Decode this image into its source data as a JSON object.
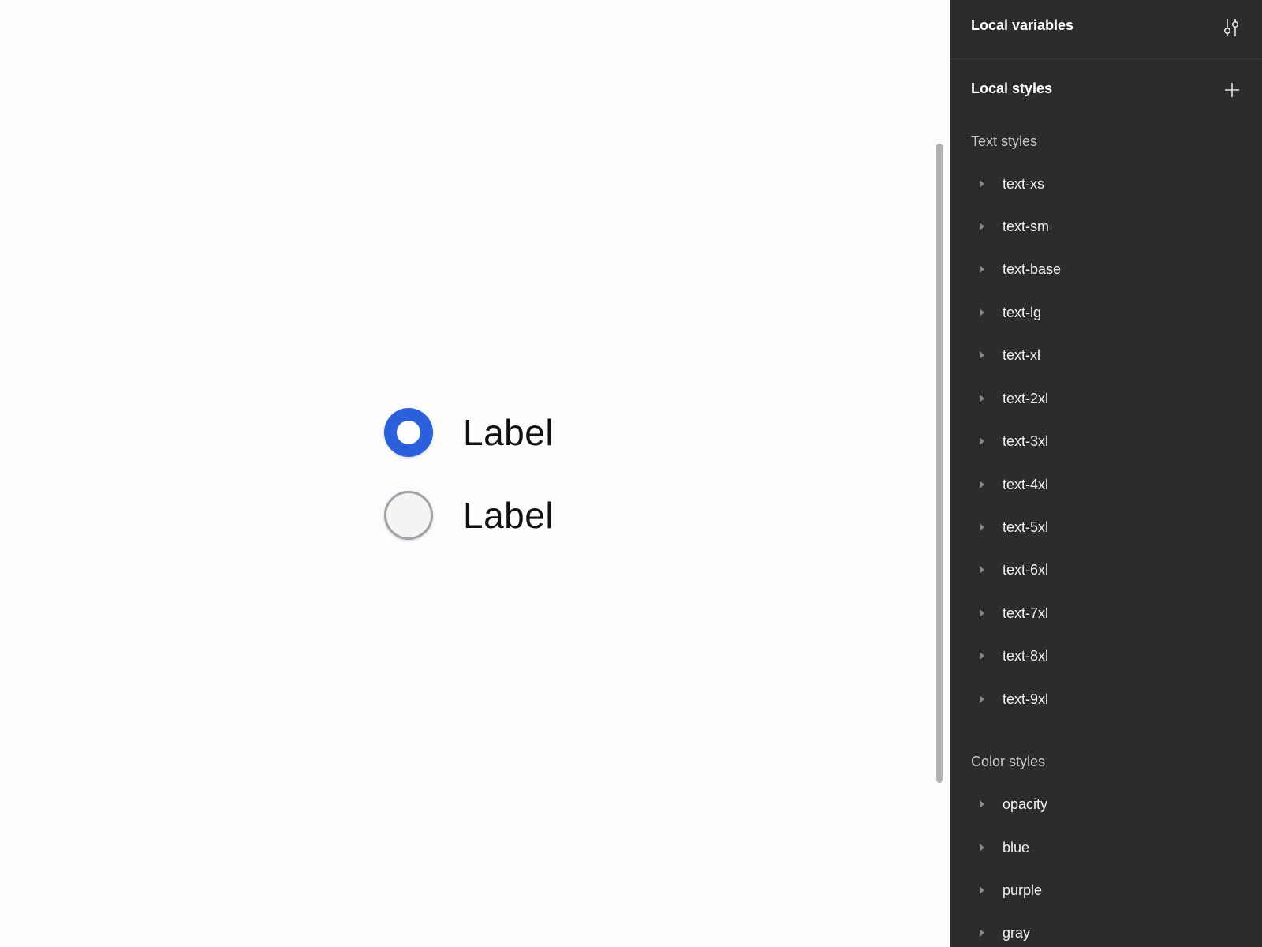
{
  "canvas": {
    "radios": [
      {
        "label": "Label",
        "checked": true
      },
      {
        "label": "Label",
        "checked": false
      }
    ],
    "accent_color": "#2b5fdc"
  },
  "panel": {
    "variables_title": "Local variables",
    "styles_title": "Local styles",
    "text_section_title": "Text styles",
    "text_styles": [
      "text-xs",
      "text-sm",
      "text-base",
      "text-lg",
      "text-xl",
      "text-2xl",
      "text-3xl",
      "text-4xl",
      "text-5xl",
      "text-6xl",
      "text-7xl",
      "text-8xl",
      "text-9xl"
    ],
    "color_section_title": "Color styles",
    "color_styles": [
      "opacity",
      "blue",
      "purple",
      "gray"
    ],
    "icons": {
      "variables": "sliders-icon",
      "styles": "plus-icon",
      "item": "caret-right-icon"
    }
  }
}
